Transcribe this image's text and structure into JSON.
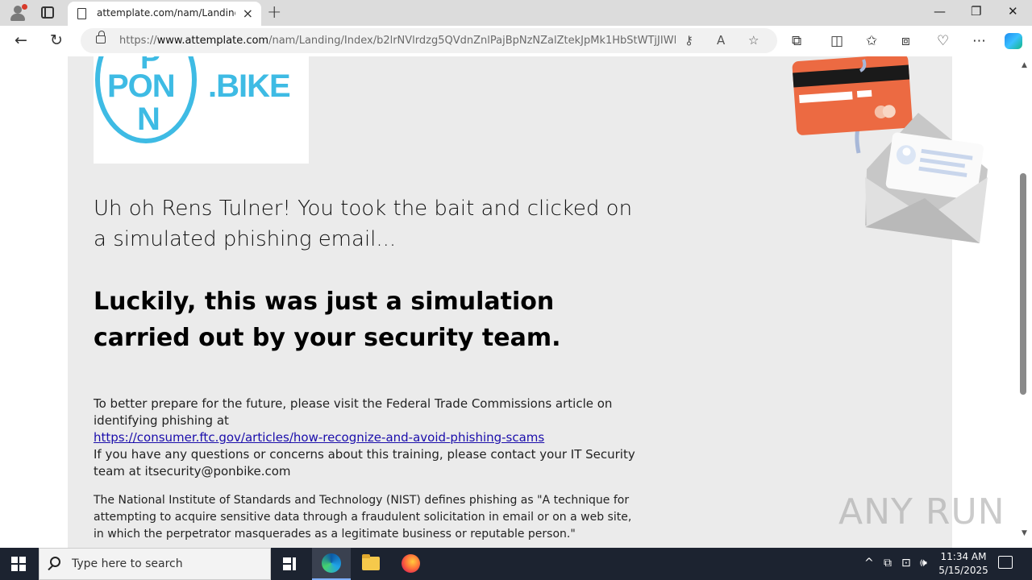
{
  "browser": {
    "tab_title": "attemplate.com/nam/Landing/Ir",
    "url_prefix": "https://",
    "url_domain": "www.attemplate.com",
    "url_path": "/nam/Landing/Index/b2lrNVlrdzg5QVdnZnlPajBpNzNZalZtekJpMk1HbStWTjJIWHV...",
    "icons": {
      "profile": "profile-icon",
      "tabs": "tab-actions-icon",
      "page": "page-icon",
      "close_tab": "×",
      "new_tab": "+",
      "minimize": "—",
      "restore": "❐",
      "close_window": "✕",
      "back": "←",
      "refresh": "↻",
      "key": "⚷",
      "read_aloud": "A",
      "favorite": "☆",
      "extensions": "⧉",
      "split": "◫",
      "favorites": "✩",
      "collections": "⧈",
      "performance": "♡",
      "more": "⋯"
    }
  },
  "page": {
    "logo": {
      "p_top": "P",
      "pon": "PON",
      "n_bottom": "N",
      "bike": ".BIKE"
    },
    "heading": "Uh oh Rens Tulner! You took the bait and clicked on a simulated phishing email...",
    "subheading": "Luckily, this was just a simulation carried out by your security team.",
    "para_1": "To better prepare for the future, please visit the Federal Trade Commissions article on identifying phishing at",
    "ftc_link": "https://consumer.ftc.gov/articles/how-recognize-and-avoid-phishing-scams",
    "para_2": "If you have any questions or concerns about this training, please contact your IT Security team at itsecurity@ponbike.com",
    "nist_text": "The National Institute of Standards and Technology (NIST) defines phishing as \"A technique for attempting to acquire sensitive data through a fraudulent solicitation in email or on a web site, in which the perpetrator masquerades as a legitimate business or reputable person.\"",
    "colors": {
      "logo_blue": "#3ebbe4",
      "card_orange": "#ec6a42",
      "content_bg": "#ebebeb"
    }
  },
  "watermark": "ANY RUN",
  "taskbar": {
    "search_placeholder": "Type here to search",
    "time": "11:34 AM",
    "date": "5/15/2025",
    "tray_icons": {
      "chevron": "^",
      "network": "⊡",
      "volume": "🕪"
    }
  }
}
